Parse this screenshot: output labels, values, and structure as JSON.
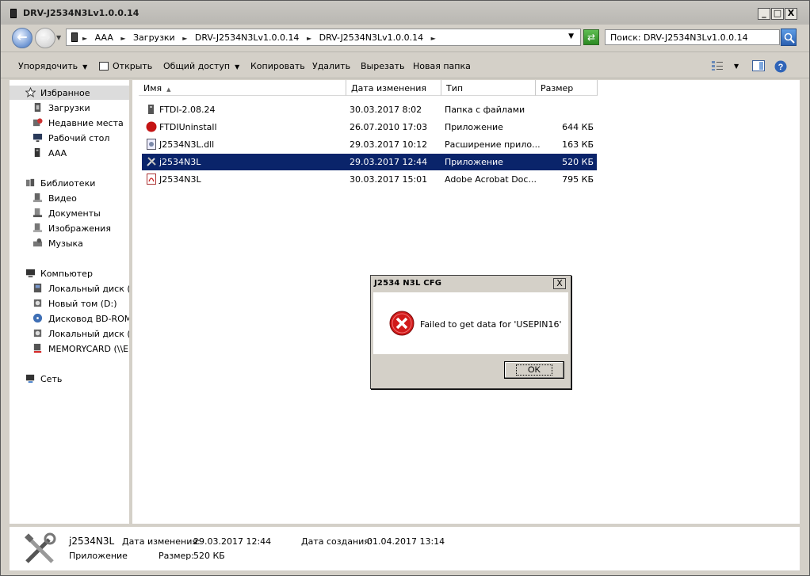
{
  "window": {
    "title": "DRV-J2534N3Lv1.0.0.14",
    "buttons": {
      "minimize": "_",
      "maximize": "□",
      "close": "X"
    }
  },
  "address": {
    "crumbs": [
      "AAA",
      "Загрузки",
      "DRV-J2534N3Lv1.0.0.14",
      "DRV-J2534N3Lv1.0.0.14"
    ],
    "search_value": "Поиск: DRV-J2534N3Lv1.0.0.14"
  },
  "toolbar": {
    "organize": "Упорядочить",
    "open": "Открыть",
    "share": "Общий доступ",
    "copy": "Копировать",
    "delete": "Удалить",
    "cut": "Вырезать",
    "new_folder": "Новая папка"
  },
  "nav": {
    "favorites": "Избранное",
    "downloads": "Загрузки",
    "recent": "Недавние места",
    "desktop": "Рабочий стол",
    "aaa": "AAA",
    "libraries": "Библиотеки",
    "video": "Видео",
    "documents": "Документы",
    "images": "Изображения",
    "music": "Музыка",
    "computer": "Компьютер",
    "local_c": "Локальный диск (C:",
    "new_d": "Новый том (D:)",
    "bdrom": "Дисковод BD-ROM (",
    "local_g": "Локальный диск (G:",
    "memorycard": "MEMORYCARD (\\\\EPS",
    "network": "Сеть"
  },
  "columns": {
    "name": "Имя",
    "date": "Дата изменения",
    "type": "Тип",
    "size": "Размер"
  },
  "files": [
    {
      "name": "FTDI-2.08.24",
      "date": "30.03.2017 8:02",
      "type": "Папка с файлами",
      "size": ""
    },
    {
      "name": "FTDIUninstall",
      "date": "26.07.2010 17:03",
      "type": "Приложение",
      "size": "644 КБ"
    },
    {
      "name": "J2534N3L.dll",
      "date": "29.03.2017 10:12",
      "type": "Расширение прило...",
      "size": "163 КБ"
    },
    {
      "name": "j2534N3L",
      "date": "29.03.2017 12:44",
      "type": "Приложение",
      "size": "520 КБ"
    },
    {
      "name": "J2534N3L",
      "date": "30.03.2017 15:01",
      "type": "Adobe Acrobat Doc...",
      "size": "795 КБ"
    }
  ],
  "details": {
    "name": "j2534N3L",
    "kind": "Приложение",
    "modified_label": "Дата изменения:",
    "modified_value": "29.03.2017 12:44",
    "created_label": "Дата создания:",
    "created_value": "01.04.2017 13:14",
    "size_label": "Размер:",
    "size_value": "520 КБ"
  },
  "dialog": {
    "title": "J2534 N3L CFG",
    "message": "Failed to get data for 'USEPIN16'",
    "ok": "OK",
    "close": "X"
  },
  "colors": {
    "selection": "#0a246a",
    "error_red": "#d11a1a",
    "chrome": "#d4d0c8"
  }
}
